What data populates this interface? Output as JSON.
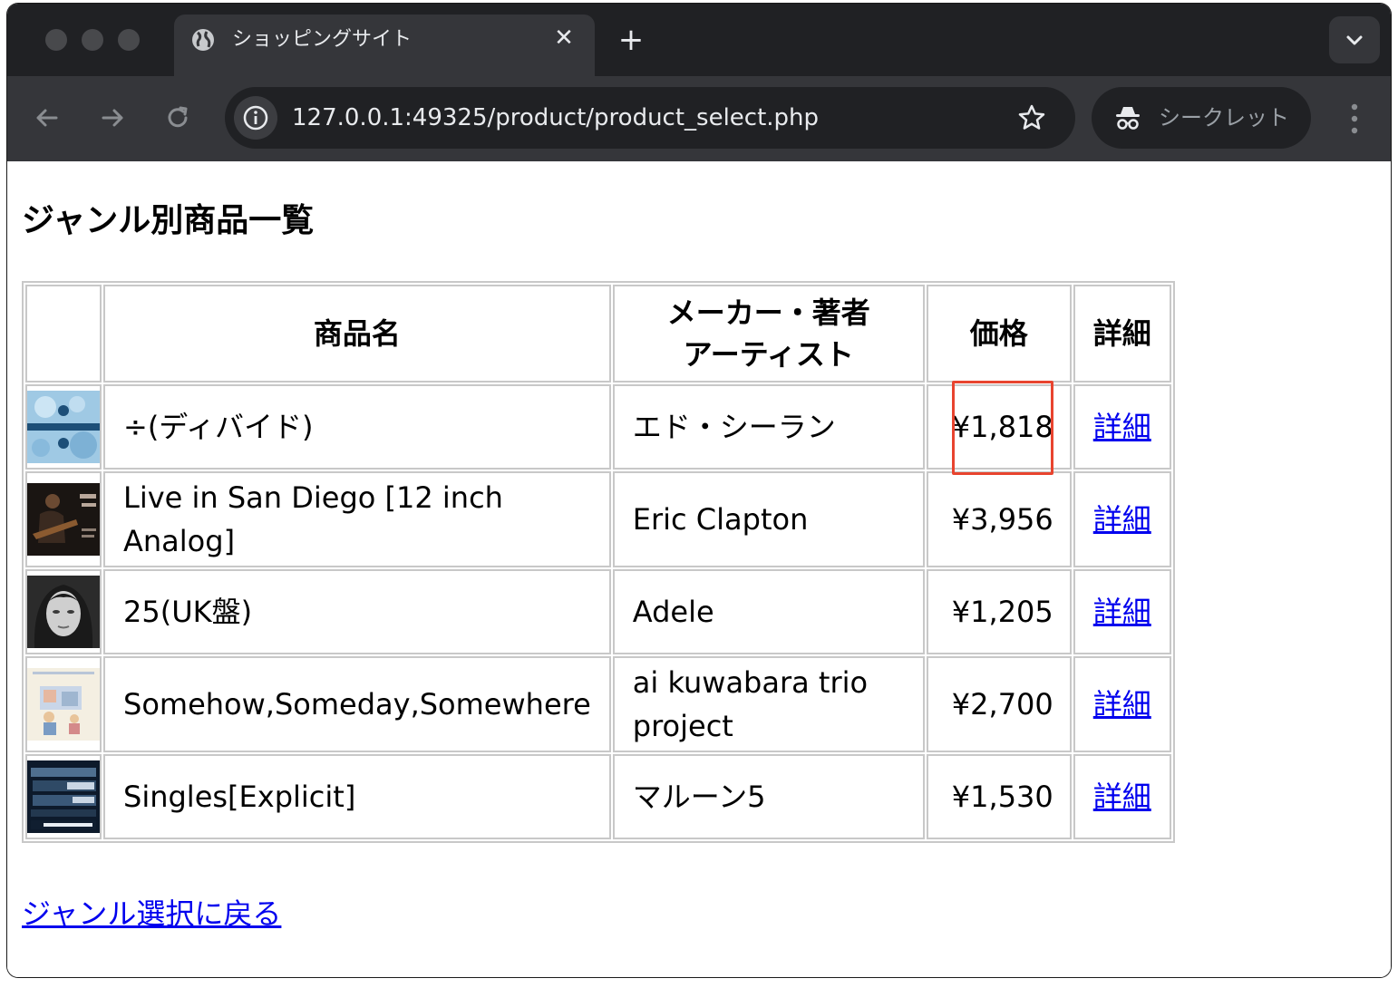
{
  "browser": {
    "tab_title": "ショッピングサイト",
    "url": "127.0.0.1:49325/product/product_select.php",
    "incognito_label": "シークレット"
  },
  "page": {
    "heading": "ジャンル別商品一覧",
    "back_link": "ジャンル選択に戻る"
  },
  "table": {
    "headers": {
      "name": "商品名",
      "maker_line1": "メーカー・著者",
      "maker_line2": "アーティスト",
      "price": "価格",
      "detail": "詳細"
    },
    "rows": [
      {
        "name": "÷(ディバイド)",
        "maker": "エド・シーラン",
        "price": "¥1,818",
        "detail": "詳細",
        "cover": "divide-cover"
      },
      {
        "name": "Live in San Diego [12 inch Analog]",
        "maker": "Eric Clapton",
        "price": "¥3,956",
        "detail": "詳細",
        "cover": "clapton-cover"
      },
      {
        "name": "25(UK盤)",
        "maker": "Adele",
        "price": "¥1,205",
        "detail": "詳細",
        "cover": "adele-cover"
      },
      {
        "name": "Somehow,Someday,Somewhere",
        "maker": "ai kuwabara trio project",
        "price": "¥2,700",
        "detail": "詳細",
        "cover": "kuwabara-cover"
      },
      {
        "name": "Singles[Explicit]",
        "maker": "マルーン5",
        "price": "¥1,530",
        "detail": "詳細",
        "cover": "singles-cover"
      }
    ]
  },
  "colors": {
    "link": "#0000ee",
    "highlight": "#e8442f",
    "tabstrip": "#202124",
    "toolbar": "#35363a"
  }
}
